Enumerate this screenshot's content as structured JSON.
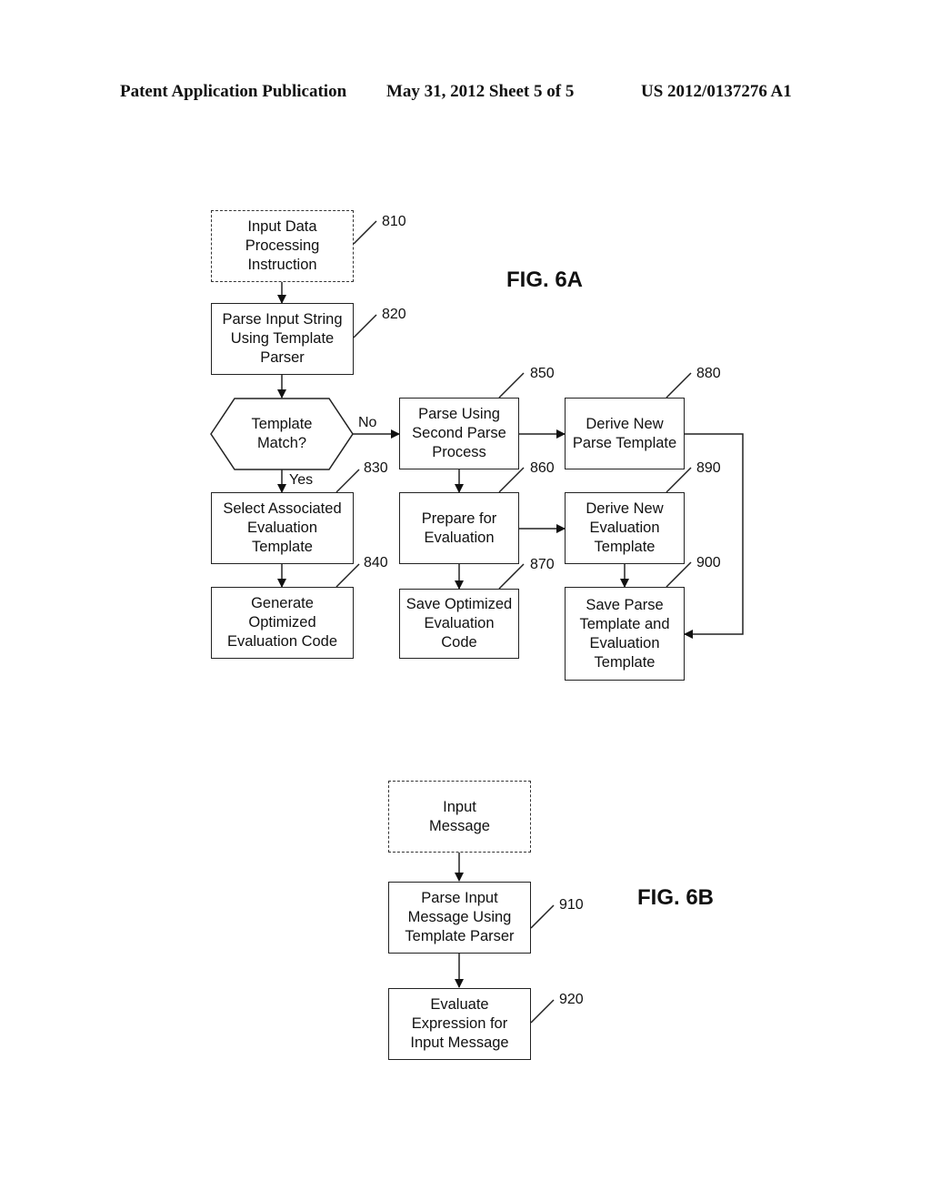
{
  "header": {
    "publication": "Patent Application Publication",
    "date_sheet": "May 31, 2012  Sheet 5 of 5",
    "number": "US 2012/0137276 A1"
  },
  "fig6a": {
    "title": "FIG. 6A",
    "nodes": {
      "n810": {
        "label": "Input Data\nProcessing\nInstruction",
        "ref": "810"
      },
      "n820": {
        "label": "Parse Input String\nUsing Template\nParser",
        "ref": "820"
      },
      "decision": {
        "label": "Template\nMatch?"
      },
      "n830": {
        "label": "Select Associated\nEvaluation\nTemplate",
        "ref": "830"
      },
      "n840": {
        "label": "Generate\nOptimized\nEvaluation Code",
        "ref": "840"
      },
      "n850": {
        "label": "Parse Using\nSecond Parse\nProcess",
        "ref": "850"
      },
      "n860": {
        "label": "Prepare for\nEvaluation",
        "ref": "860"
      },
      "n870": {
        "label": "Save Optimized\nEvaluation\nCode",
        "ref": "870"
      },
      "n880": {
        "label": "Derive New\nParse Template",
        "ref": "880"
      },
      "n890": {
        "label": "Derive New\nEvaluation\nTemplate",
        "ref": "890"
      },
      "n900": {
        "label": "Save Parse\nTemplate and\nEvaluation\nTemplate",
        "ref": "900"
      }
    },
    "edge_labels": {
      "no": "No",
      "yes": "Yes"
    }
  },
  "fig6b": {
    "title": "FIG. 6B",
    "nodes": {
      "input": {
        "label": "Input\nMessage"
      },
      "n910": {
        "label": "Parse Input\nMessage Using\nTemplate Parser",
        "ref": "910"
      },
      "n920": {
        "label": "Evaluate\nExpression for\nInput Message",
        "ref": "920"
      }
    }
  }
}
